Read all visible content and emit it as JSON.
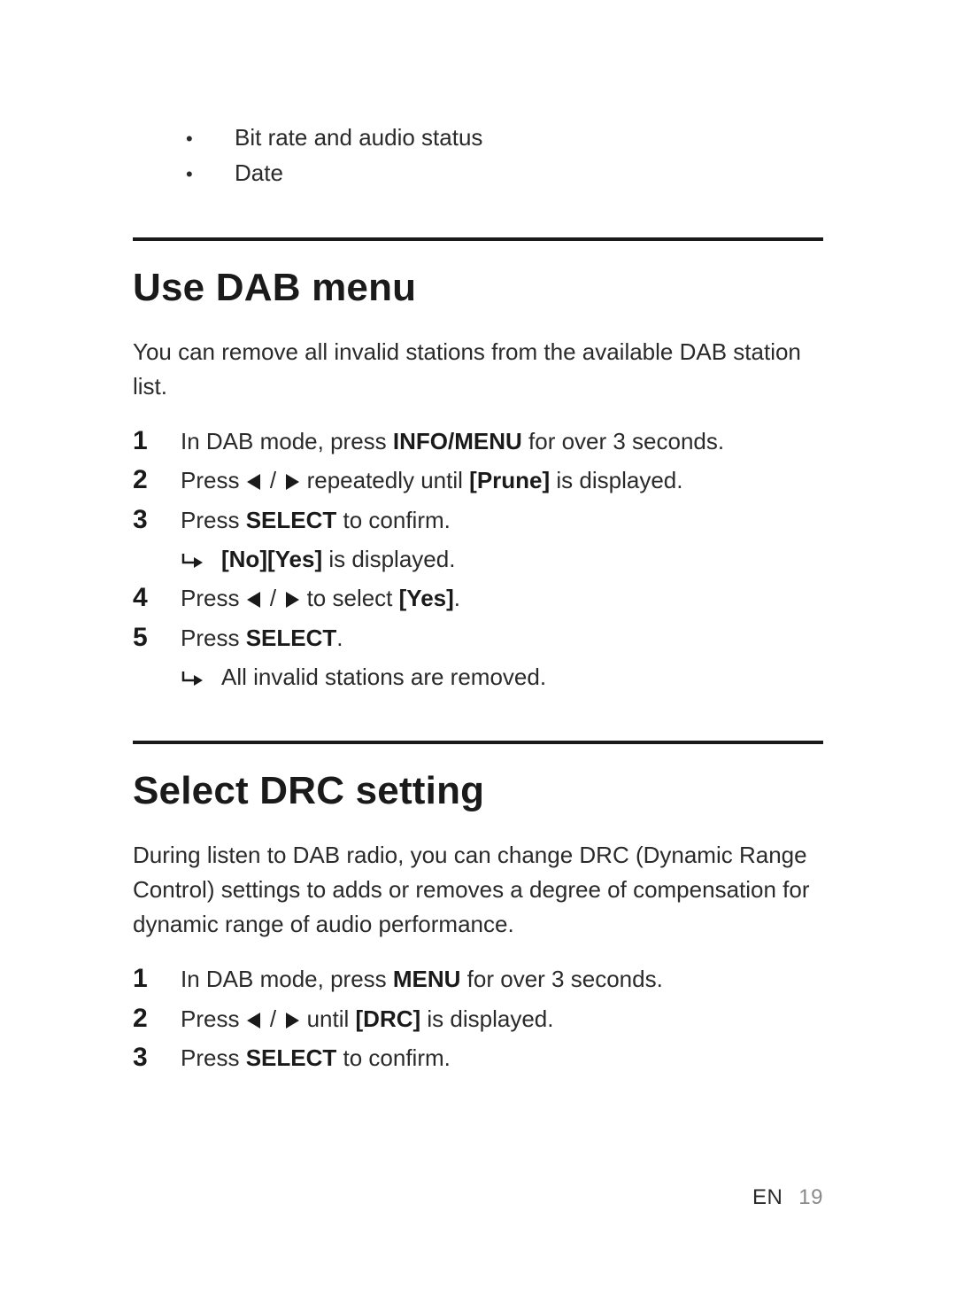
{
  "topBullets": [
    "Bit rate and audio status",
    "Date"
  ],
  "section1": {
    "heading": "Use DAB menu",
    "intro": "You can remove all invalid stations from the available DAB station list.",
    "steps": {
      "s1": {
        "pre": "In DAB mode, press ",
        "bold": "INFO/MENU",
        "post": " for over 3 seconds."
      },
      "s2": {
        "pre": "Press ",
        "mid": " repeatedly until ",
        "bold": "[Prune]",
        "post": " is displayed."
      },
      "s3": {
        "pre": "Press ",
        "bold": "SELECT",
        "post": " to confirm.",
        "sub": {
          "bold": "[No][Yes]",
          "post": " is displayed."
        }
      },
      "s4": {
        "pre": "Press ",
        "mid": " to select ",
        "bold": "[Yes]",
        "post": "."
      },
      "s5": {
        "pre": "Press ",
        "bold": "SELECT",
        "post": ".",
        "sub": {
          "text": "All invalid stations are removed."
        }
      }
    }
  },
  "section2": {
    "heading": "Select DRC setting",
    "intro": "During listen to DAB radio, you can change DRC (Dynamic Range Control) settings to adds or removes a degree of compensation for dynamic range of audio performance.",
    "steps": {
      "s1": {
        "pre": "In DAB mode, press ",
        "bold": "MENU",
        "post": " for over 3 seconds."
      },
      "s2": {
        "pre": "Press ",
        "mid": " until ",
        "bold": "[DRC]",
        "post": " is displayed."
      },
      "s3": {
        "pre": "Press ",
        "bold": "SELECT",
        "post": " to confirm."
      }
    }
  },
  "footer": {
    "lang": "EN",
    "page": "19"
  }
}
